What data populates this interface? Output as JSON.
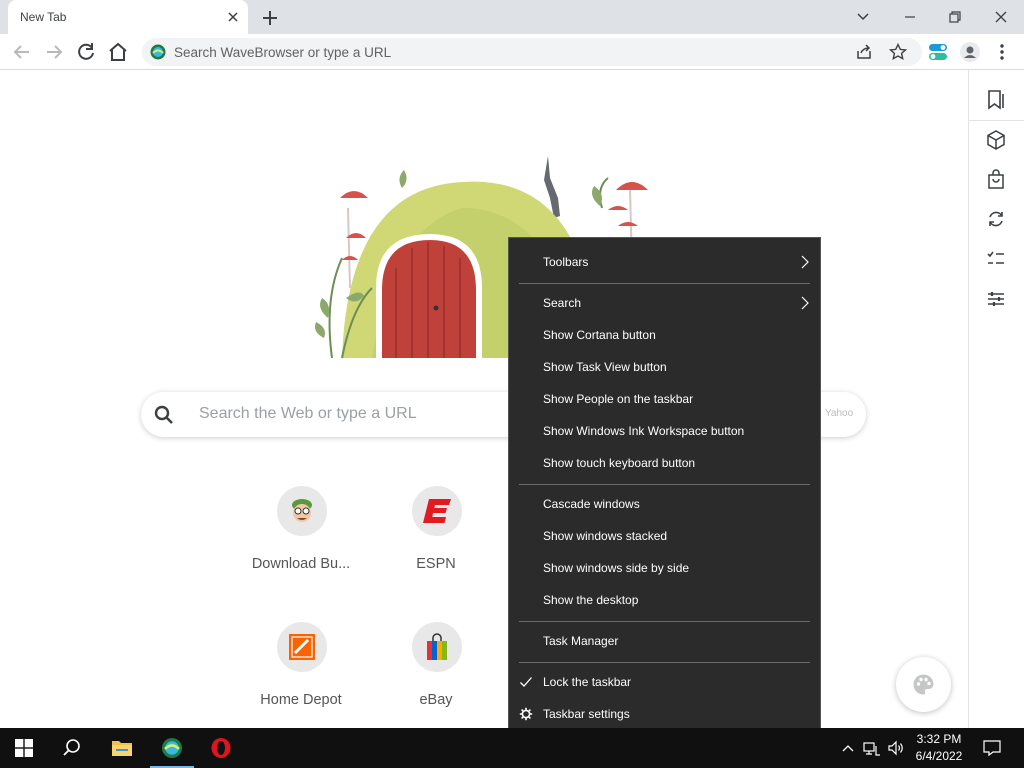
{
  "browser": {
    "tab_title": "New Tab",
    "omnibox_placeholder": "Search WaveBrowser or type a URL"
  },
  "new_tab_page": {
    "search_placeholder": "Search the Web or type a URL",
    "search_engine": "Yahoo",
    "shortcuts": [
      {
        "label": "Download Bu...",
        "icon": "download-buddy-icon"
      },
      {
        "label": "ESPN",
        "icon": "espn-icon"
      },
      {
        "label": "Home Depot",
        "icon": "home-depot-icon"
      },
      {
        "label": "eBay",
        "icon": "ebay-icon"
      }
    ]
  },
  "context_menu": {
    "items": [
      {
        "label": "Toolbars",
        "submenu": true
      },
      {
        "label": "Search",
        "submenu": true
      },
      {
        "label": "Show Cortana button"
      },
      {
        "label": "Show Task View button"
      },
      {
        "label": "Show People on the taskbar"
      },
      {
        "label": "Show Windows Ink Workspace button"
      },
      {
        "label": "Show touch keyboard button"
      },
      {
        "label": "Cascade windows"
      },
      {
        "label": "Show windows stacked"
      },
      {
        "label": "Show windows side by side"
      },
      {
        "label": "Show the desktop"
      },
      {
        "label": "Task Manager"
      },
      {
        "label": "Lock the taskbar",
        "checked": true
      },
      {
        "label": "Taskbar settings",
        "icon": "gear-icon"
      }
    ]
  },
  "taskbar": {
    "time": "3:32 PM",
    "date": "6/4/2022"
  },
  "colors": {
    "accent": "#76b9ed",
    "menu_bg": "#2b2b2b",
    "taskbar_bg": "#101010"
  }
}
